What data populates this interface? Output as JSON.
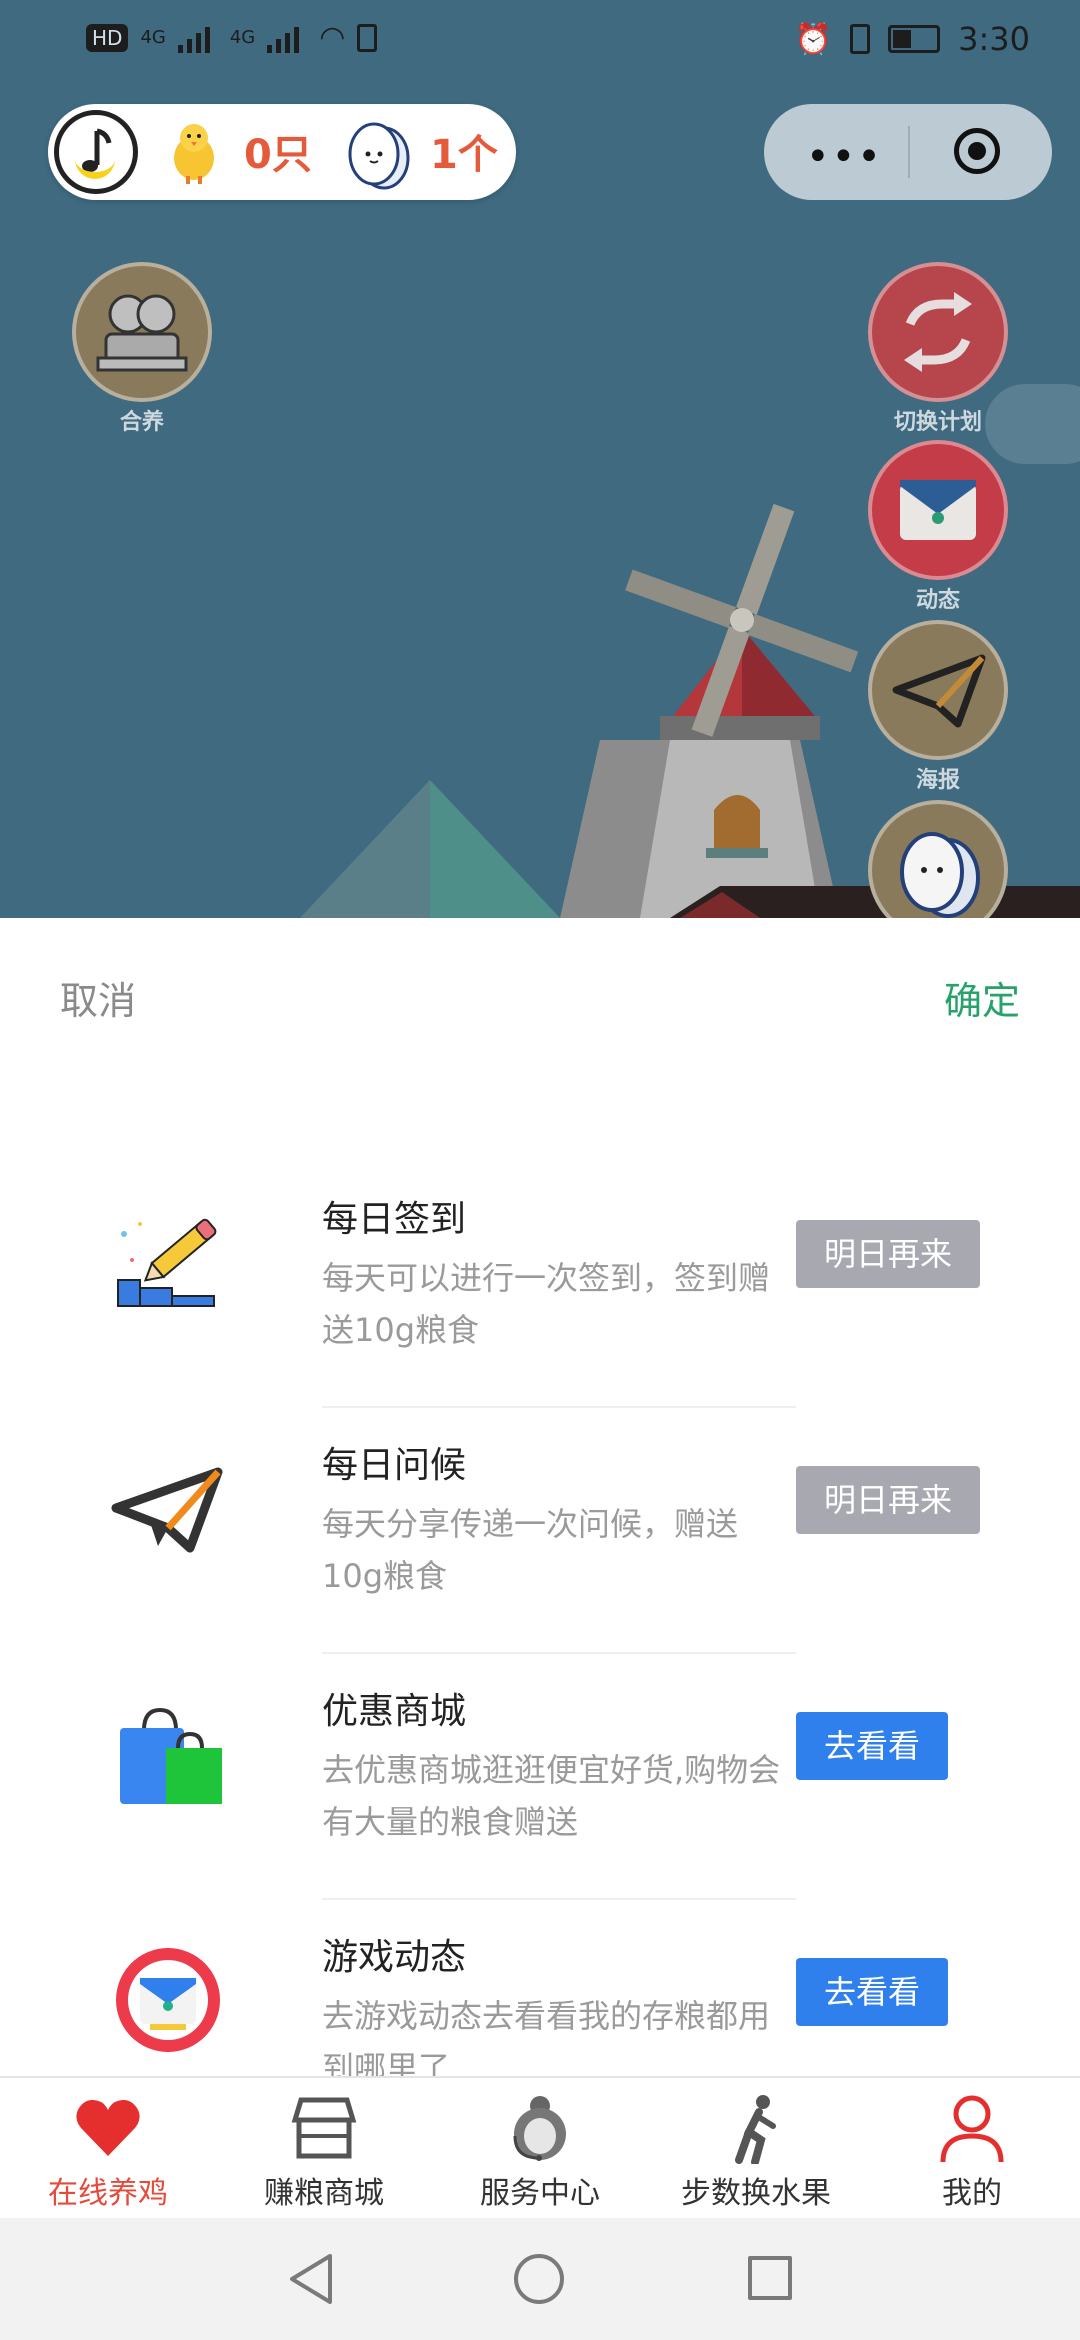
{
  "status_bar": {
    "network_badge": "HD",
    "signal_1": "4G",
    "signal_2": "4G",
    "time": "3:30"
  },
  "top_pill": {
    "chick_count": "0只",
    "egg_count": "1个"
  },
  "capsule": {
    "more_icon": "more-dots-icon",
    "close_icon": "target-icon"
  },
  "game_buttons": {
    "co_raise": "合养",
    "switch_plan": "切换计划",
    "activity": "动态",
    "poster": "海报"
  },
  "sheet": {
    "cancel": "取消",
    "confirm": "确定",
    "tasks": [
      {
        "title": "每日签到",
        "description": "每天可以进行一次签到，签到赠送10g粮食",
        "button": "明日再来",
        "icon": "pencil-signin-icon"
      },
      {
        "title": "每日问候",
        "description": "每天分享传递一次问候，赠送10g粮食",
        "button": "明日再来",
        "icon": "paper-plane-icon"
      },
      {
        "title": "优惠商城",
        "description": "去优惠商城逛逛便宜好货,购物会有大量的粮食赠送",
        "button": "去看看",
        "icon": "shopping-bag-icon"
      },
      {
        "title": "游戏动态",
        "description": "去游戏动态去看看我的存粮都用到哪里了",
        "button": "去看看",
        "icon": "mail-badge-icon"
      }
    ]
  },
  "tabbar": {
    "items": [
      {
        "label": "在线养鸡",
        "icon": "heart-icon"
      },
      {
        "label": "赚粮商城",
        "icon": "store-icon"
      },
      {
        "label": "服务中心",
        "icon": "customer-service-icon"
      },
      {
        "label": "步数换水果",
        "icon": "walking-icon"
      },
      {
        "label": "我的",
        "icon": "user-icon"
      }
    ]
  },
  "colors": {
    "accent_red": "#e54a3a",
    "confirm_green": "#27a26a",
    "button_blue": "#2f80ed",
    "button_gray": "#a7a8b0"
  }
}
